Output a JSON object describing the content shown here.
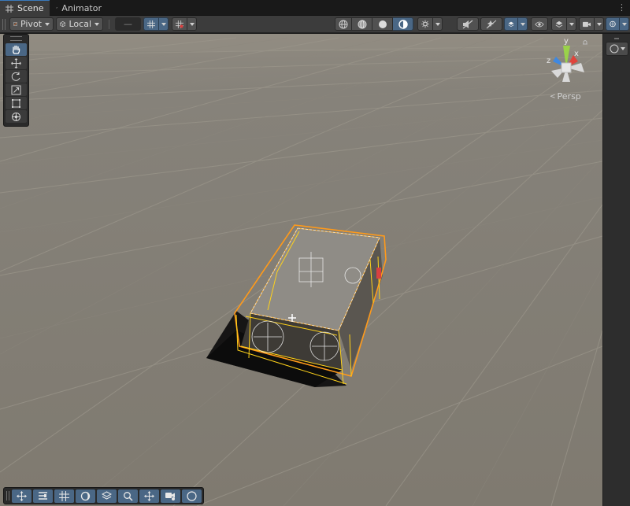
{
  "tabs": [
    {
      "label": "Scene",
      "icon": "grid-icon",
      "active": true
    },
    {
      "label": "Animator",
      "icon": "animator-icon",
      "active": false
    }
  ],
  "toolbar": {
    "pivot_label": "Pivot",
    "local_label": "Local",
    "snap_value": "—"
  },
  "tools": [
    "hand-tool",
    "move-tool",
    "rotate-tool",
    "scale-tool",
    "rect-tool",
    "transform-tool"
  ],
  "gizmo": {
    "view_label": "Persp",
    "axes": [
      "y",
      "x",
      "z"
    ],
    "colors": {
      "x": "#e0443c",
      "y": "#9ad24a",
      "z": "#3f88e0"
    }
  },
  "bottom_toolbar": [
    "move-icon",
    "align-icon",
    "grid-icon",
    "snap-icon",
    "layers-icon",
    "search-icon",
    "pan-icon",
    "camera-icon",
    "compass-icon"
  ],
  "colors": {
    "accent": "#4a6785",
    "selection": "#ff9a1a",
    "ground": "#807b70"
  }
}
